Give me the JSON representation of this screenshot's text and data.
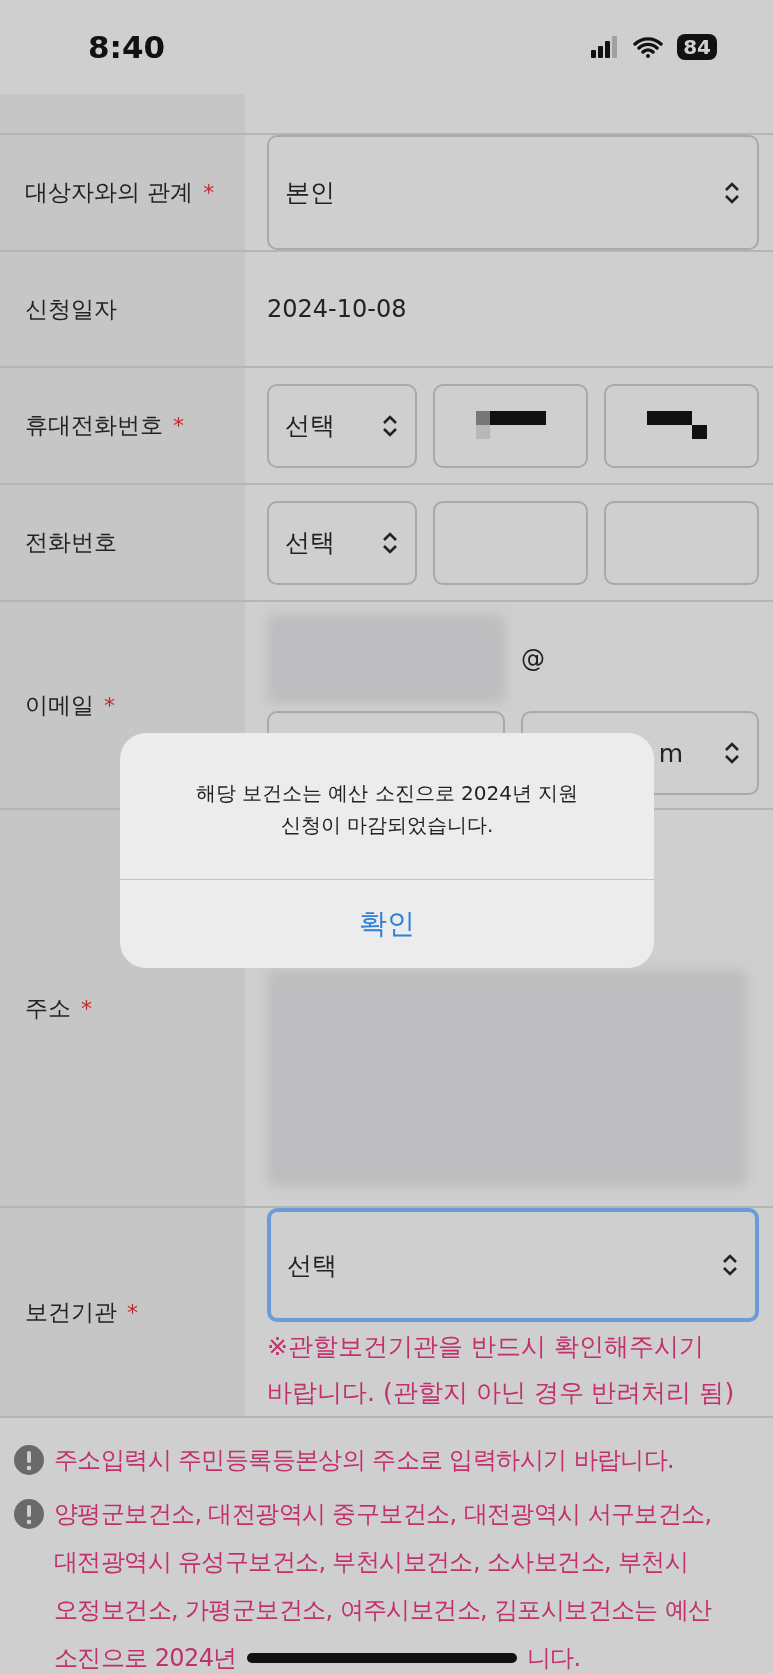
{
  "status_bar": {
    "time": "8:40",
    "battery": "84"
  },
  "form": {
    "rows": [
      {
        "kind": "blank"
      },
      {
        "kind": "select",
        "label": "대상자와의 관계",
        "required_mark": "*",
        "value": "본인"
      },
      {
        "kind": "text",
        "label": "신청일자",
        "value": "2024-10-08"
      },
      {
        "kind": "phone",
        "label": "휴대전화번호",
        "required_mark": "*",
        "prefix": "선택",
        "redacted": true
      },
      {
        "kind": "phone",
        "label": "전화번호",
        "prefix": "선택",
        "redacted": false
      },
      {
        "kind": "email",
        "label": "이메일",
        "required_mark": "*",
        "at": "@",
        "domain": "m"
      },
      {
        "kind": "address",
        "label": "주소",
        "required_mark": "*"
      },
      {
        "kind": "agency",
        "label": "보건기관",
        "required_mark": "*",
        "value": "선택",
        "focused": true,
        "note": "※관할보건기관을 반드시 확인해주시기 바랍니다. (관할지 아닌 경우 반려처리 됨)"
      }
    ]
  },
  "notices": [
    {
      "text": "주소입력시 주민등록등본상의 주소로 입력하시기 바랍니다."
    },
    {
      "text": "양평군보건소, 대전광역시 중구보건소, 대전광역시 서구보건소, 대전광역시 유성구보건소, 부천시보건소, 소사보건소, 부천시 오정보건소, 가평군보건소, 여주시보건소, 김포시보건소는 예산",
      "last_line": [
        "소진으로 2024년",
        "니다."
      ]
    }
  ],
  "alert": {
    "message": "해당 보건소는 예산 소진으로 2024년 지원 신청이 마감되었습니다.",
    "button": "확인"
  }
}
